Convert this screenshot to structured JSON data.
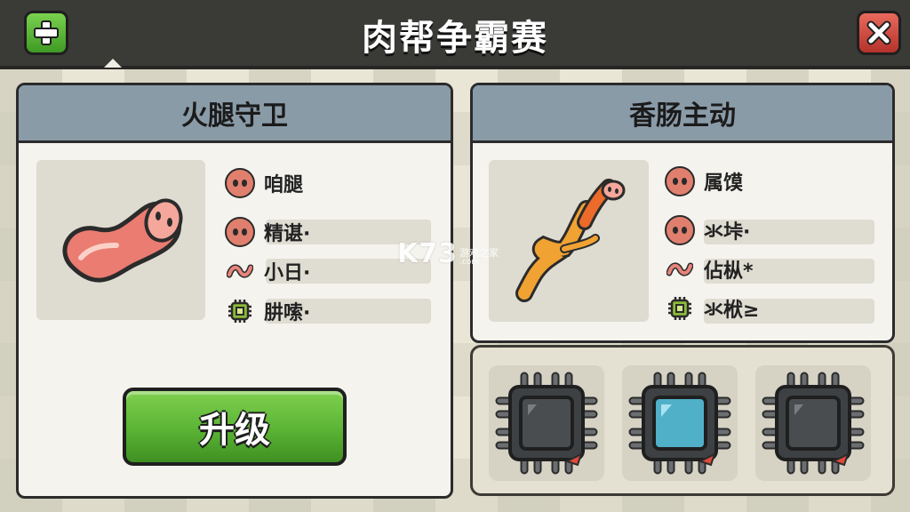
{
  "header": {
    "title": "肉帮争霸赛",
    "add_icon": "plus-icon",
    "close_icon": "close-icon"
  },
  "left_card": {
    "title": "火腿守卫",
    "stats": [
      {
        "icon": "pig-face-icon",
        "label": "咱腿"
      },
      {
        "icon": "pig-face-icon",
        "label": "精谌·"
      },
      {
        "icon": "worm-icon",
        "label": "小日·"
      },
      {
        "icon": "chip-icon",
        "label": "肼嗦·"
      }
    ],
    "upgrade_label": "升级"
  },
  "right_card": {
    "title": "香肠主动",
    "stats": [
      {
        "icon": "pig-face-icon",
        "label": "属馍"
      },
      {
        "icon": "pig-face-icon",
        "label": "氺垰·"
      },
      {
        "icon": "worm-icon",
        "label": "佔枞*"
      },
      {
        "icon": "chip-icon",
        "label": "氺栿≥"
      }
    ]
  },
  "chip_slots": [
    {
      "state": "empty",
      "color": "#4a4d4f"
    },
    {
      "state": "active",
      "color": "#4fb0c8"
    },
    {
      "state": "empty",
      "color": "#4a4d4f"
    }
  ],
  "watermark": {
    "logo": "K73",
    "subtitle": "游戏之家",
    "url": ".com"
  },
  "colors": {
    "header_bg": "#3a3a37",
    "panel_header": "#8a9ba8",
    "upgrade_green": "#5ab434",
    "close_red": "#c8463c",
    "plus_green": "#5cb83a"
  }
}
